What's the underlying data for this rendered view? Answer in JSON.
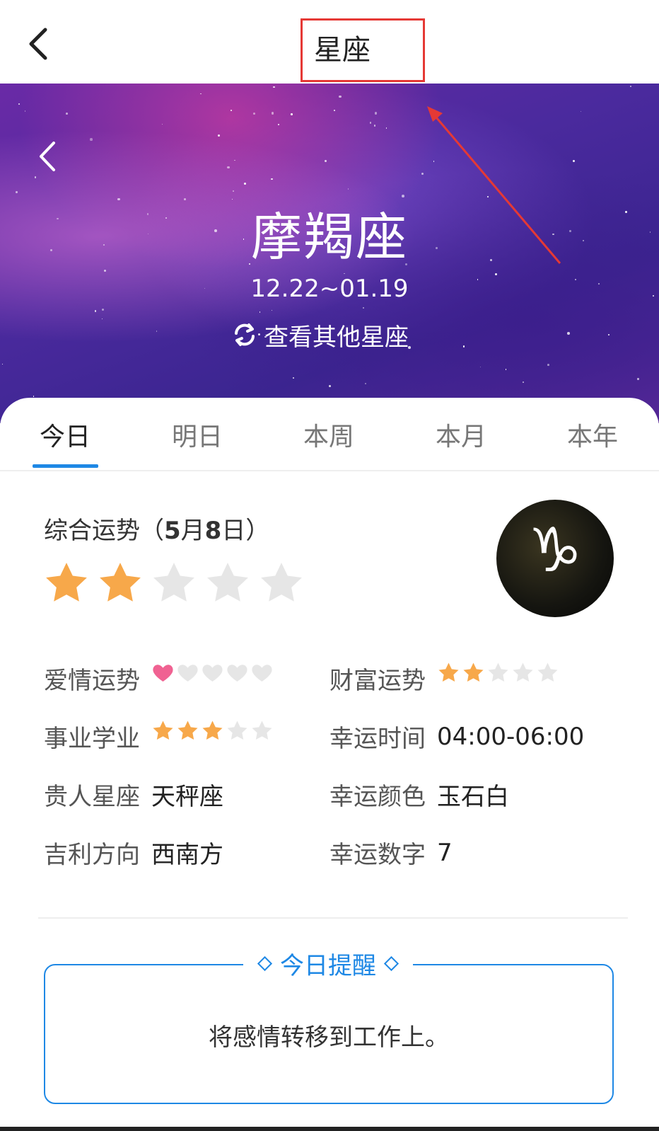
{
  "header": {
    "title": "星座"
  },
  "hero": {
    "sign_name": "摩羯座",
    "date_range": "12.22~01.19",
    "switch_label": "查看其他星座"
  },
  "tabs": [
    {
      "label": "今日",
      "active": true
    },
    {
      "label": "明日",
      "active": false
    },
    {
      "label": "本周",
      "active": false
    },
    {
      "label": "本月",
      "active": false
    },
    {
      "label": "本年",
      "active": false
    }
  ],
  "overall": {
    "label_prefix": "综合运势（",
    "month": "5",
    "month_unit": "月",
    "day": "8",
    "day_unit": "日）",
    "rating": 2,
    "max": 5
  },
  "emblem_symbol": "♑",
  "details": {
    "love": {
      "label": "爱情运势",
      "rating": 1,
      "max": 5
    },
    "wealth": {
      "label": "财富运势",
      "rating": 2,
      "max": 5
    },
    "career": {
      "label": "事业学业",
      "rating": 3,
      "max": 5
    },
    "lucky_time": {
      "label": "幸运时间",
      "value": "04:00-06:00"
    },
    "noble_sign": {
      "label": "贵人星座",
      "value": "天秤座"
    },
    "lucky_color": {
      "label": "幸运颜色",
      "value": "玉石白"
    },
    "lucky_direction": {
      "label": "吉利方向",
      "value": "西南方"
    },
    "lucky_number": {
      "label": "幸运数字",
      "value": "7"
    }
  },
  "reminder": {
    "title": "今日提醒",
    "text": "将感情转移到工作上。"
  },
  "colors": {
    "accent": "#1e88e5",
    "star": "#f7a84a",
    "heart": "#f06292",
    "annotation": "#e53935"
  }
}
